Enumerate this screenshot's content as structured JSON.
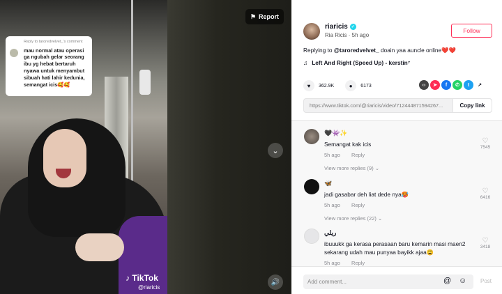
{
  "video": {
    "report_label": "Report",
    "reply_card": {
      "header": "Reply to taroredvelvet_'s comment",
      "text": "mau normal atau operasi ga ngubah gelar seorang ibu yg hebat bertaruh nyawa untuk menyambut sibuah hati lahir kedunia, semangat icis🥰🥰"
    },
    "watermark_brand": "TikTok",
    "watermark_user": "@riaricis"
  },
  "author": {
    "username": "riaricis",
    "display_sub": "Ria Ricis · 5h ago",
    "follow_label": "Follow"
  },
  "description": {
    "prefix": "Replying to ",
    "mention": "@taroredvelvet_",
    "text": " doain yaa auncle online❤️❤️"
  },
  "music": {
    "icon": "music-note-icon",
    "title": "Left And Right (Speed Up) - kerstin⁷"
  },
  "stats": {
    "likes": "362.9K",
    "comments": "6173"
  },
  "share_icons": [
    {
      "name": "embed-icon",
      "color": "#444444",
      "glyph": "‹›"
    },
    {
      "name": "send-icon",
      "color": "#fe2c55",
      "glyph": "➤"
    },
    {
      "name": "facebook-icon",
      "color": "#1877f2",
      "glyph": "f"
    },
    {
      "name": "whatsapp-icon",
      "color": "#25d366",
      "glyph": "✆"
    },
    {
      "name": "twitter-icon",
      "color": "#1da1f2",
      "glyph": "t"
    },
    {
      "name": "share-arrow-icon",
      "color": "#ffffff",
      "glyph": "↗"
    }
  ],
  "link": {
    "url": "https://www.tiktok.com/@riaricis/video/712444871594267...",
    "copy_label": "Copy link"
  },
  "comments": [
    {
      "name": "🖤👾✨",
      "text": "Semangat kak icis",
      "time": "5h ago",
      "reply_label": "Reply",
      "likes": "7545",
      "more": "View more replies (9)"
    },
    {
      "name": "🦋",
      "text": "jadi gasabar deh liat dede nya🥵",
      "time": "5h ago",
      "reply_label": "Reply",
      "likes": "6416",
      "more": "View more replies (22)"
    },
    {
      "name": "ريلي",
      "text": "ibuuukk ga kerasa perasaan baru kemarin masi maen2 sekarang udah mau punyaa bayikk ajaa😩",
      "time": "5h ago",
      "reply_label": "Reply",
      "likes": "3418",
      "more": ""
    }
  ],
  "add_comment": {
    "placeholder": "Add comment...",
    "post_label": "Post"
  },
  "colors": {
    "accent": "#fe2c55",
    "verified": "#20d5ec"
  }
}
